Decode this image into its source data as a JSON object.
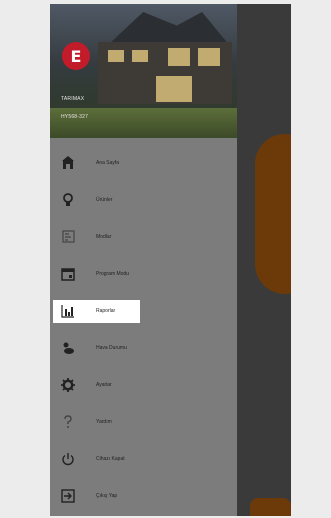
{
  "app": {
    "accent_color": "#c21c2b",
    "drawer_bg": "#7c7c7c",
    "overlay_bg": "#3a3a3a"
  },
  "header": {
    "logo_glyph": "E",
    "name": "TARIMAX",
    "code": "HY568-327"
  },
  "menu": {
    "active_index": 4,
    "items": [
      {
        "label": "Ana Sayfa",
        "icon": "home-icon"
      },
      {
        "label": "Ürünler",
        "icon": "lightbulb-icon"
      },
      {
        "label": "Modlar",
        "icon": "modes-icon"
      },
      {
        "label": "Program Modu",
        "icon": "calendar-icon"
      },
      {
        "label": "Raporlar",
        "icon": "bar-chart-icon"
      },
      {
        "label": "Hava Durumu",
        "icon": "weather-icon"
      },
      {
        "label": "Ayarlar",
        "icon": "gear-icon"
      },
      {
        "label": "Yardım",
        "icon": "help-icon"
      },
      {
        "label": "Cihazı Kapat",
        "icon": "power-icon"
      },
      {
        "label": "Çıkış Yap",
        "icon": "logout-icon"
      }
    ]
  }
}
